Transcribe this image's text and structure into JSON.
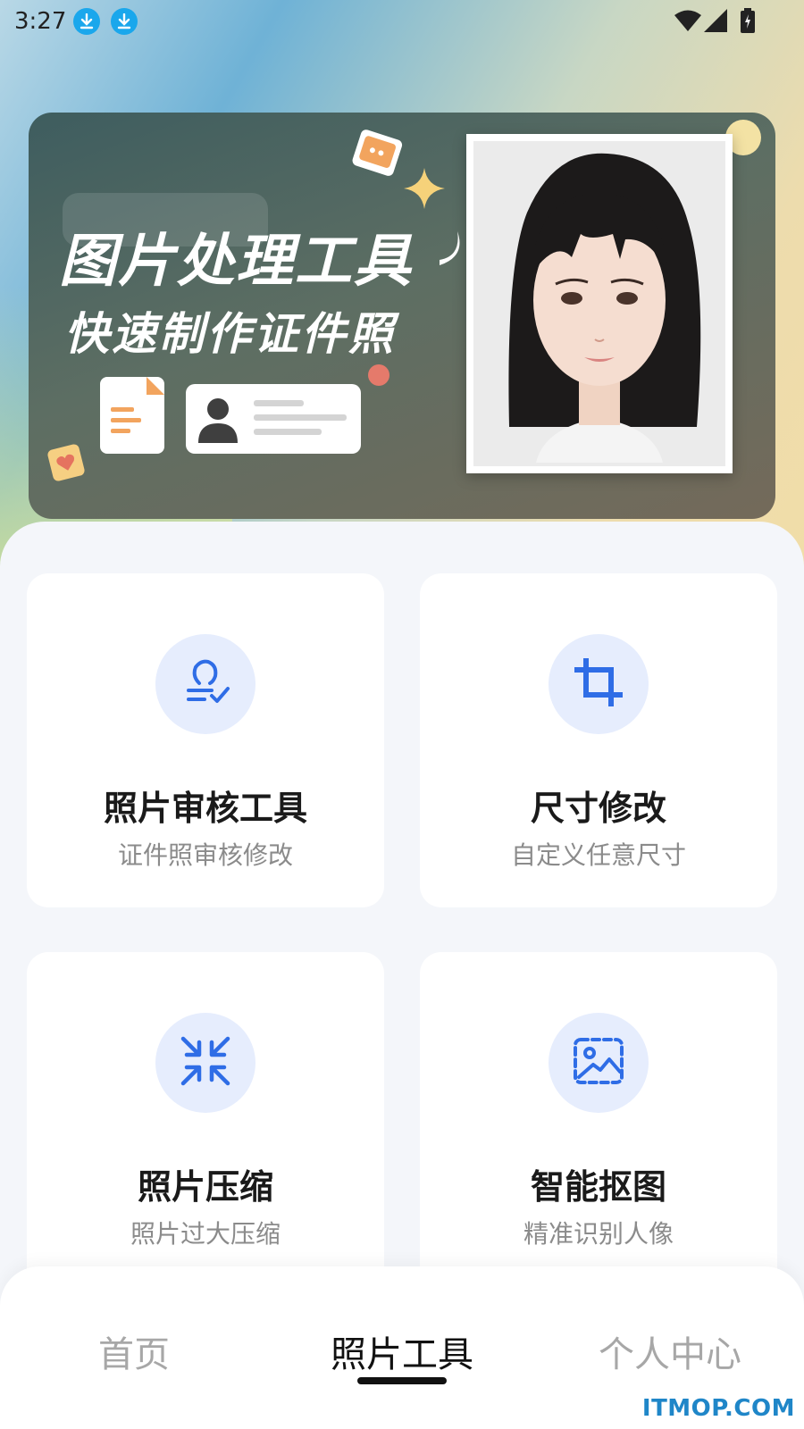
{
  "status_bar": {
    "time": "3:27",
    "icons": [
      "download-icon",
      "download-icon",
      "wifi-icon",
      "signal-icon",
      "battery-icon"
    ]
  },
  "banner": {
    "title": "图片处理工具",
    "subtitle": "快速制作证件照"
  },
  "tools": [
    {
      "title": "照片审核工具",
      "desc": "证件照审核修改",
      "icon": "review-stamp-icon"
    },
    {
      "title": "尺寸修改",
      "desc": "自定义任意尺寸",
      "icon": "crop-icon"
    },
    {
      "title": "照片压缩",
      "desc": "照片过大压缩",
      "icon": "compress-icon"
    },
    {
      "title": "智能抠图",
      "desc": "精准识别人像",
      "icon": "image-cutout-icon"
    }
  ],
  "bottom_nav": {
    "items": [
      {
        "label": "首页",
        "active": false
      },
      {
        "label": "照片工具",
        "active": true
      },
      {
        "label": "个人中心",
        "active": false
      }
    ]
  },
  "watermark": "ITMOP.COM",
  "colors": {
    "accent": "#2f6de6",
    "icon_bg": "#e6edfd",
    "nav_inactive": "#a7a7a7"
  }
}
